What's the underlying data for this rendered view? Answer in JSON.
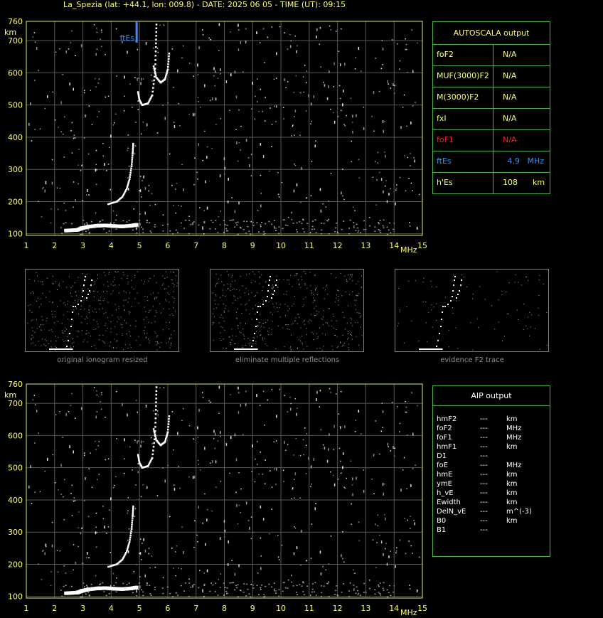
{
  "header": "La_Spezia (lat: +44.1, lon: 009.8) - DATE: 2025 06 05 - TIME (UT): 09:15",
  "colors": {
    "grid": "#5a5a5a",
    "frame": "#e8e870",
    "axis_text": "#ffff66",
    "panel_border": "#4caf50",
    "foF1": "#ff2020",
    "ftEs": "#3a8cff",
    "label_yellow": "#ffff66"
  },
  "chart_data": [
    {
      "type": "scatter",
      "name_id": "main-ionogram",
      "xlabel": "MHz",
      "ylabel": "km",
      "xlim": [
        1,
        15
      ],
      "ylim": [
        95,
        760
      ],
      "xticks": [
        "1",
        "2",
        "3",
        "4",
        "5",
        "6",
        "7",
        "8",
        "9",
        "10",
        "11",
        "12",
        "13",
        "14",
        "15"
      ],
      "yticks": [
        "100",
        "200",
        "300",
        "400",
        "500",
        "600",
        "700",
        "760"
      ],
      "ftEs_marker": {
        "label": "ftEs",
        "x": 4.9
      },
      "traces": [
        {
          "name": "es-layer",
          "points": [
            [
              2.4,
              110
            ],
            [
              2.8,
              112
            ],
            [
              3.0,
              118
            ],
            [
              3.2,
              122
            ],
            [
              3.5,
              125
            ],
            [
              3.8,
              126
            ],
            [
              4.1,
              124
            ],
            [
              4.4,
              123
            ],
            [
              4.7,
              125
            ],
            [
              4.9,
              128
            ]
          ]
        },
        {
          "name": "f1-trace",
          "points": [
            [
              3.9,
              192
            ],
            [
              4.2,
              200
            ],
            [
              4.4,
              215
            ],
            [
              4.55,
              240
            ],
            [
              4.65,
              270
            ],
            [
              4.72,
              310
            ],
            [
              4.76,
              350
            ],
            [
              4.78,
              380
            ]
          ]
        },
        {
          "name": "f2-trace-1",
          "points": [
            [
              4.95,
              540
            ],
            [
              5.0,
              515
            ],
            [
              5.1,
              500
            ],
            [
              5.3,
              505
            ],
            [
              5.45,
              530
            ],
            [
              5.55,
              600
            ],
            [
              5.58,
              680
            ],
            [
              5.6,
              750
            ]
          ]
        },
        {
          "name": "f2-trace-2",
          "points": [
            [
              5.5,
              620
            ],
            [
              5.6,
              585
            ],
            [
              5.75,
              570
            ],
            [
              5.9,
              580
            ],
            [
              6.0,
              610
            ],
            [
              6.05,
              660
            ]
          ]
        }
      ]
    },
    {
      "type": "scatter",
      "name_id": "aip-ionogram",
      "xlabel": "MHz",
      "ylabel": "km",
      "xlim": [
        1,
        15
      ],
      "ylim": [
        95,
        760
      ],
      "xticks": [
        "1",
        "2",
        "3",
        "4",
        "5",
        "6",
        "7",
        "8",
        "9",
        "10",
        "11",
        "12",
        "13",
        "14",
        "15"
      ],
      "yticks": [
        "100",
        "200",
        "300",
        "400",
        "500",
        "600",
        "700",
        "760"
      ]
    }
  ],
  "autoscala": {
    "title": "AUTOSCALA output",
    "rows": [
      {
        "param": "foF2",
        "value": "N/A",
        "unit": ""
      },
      {
        "param": "MUF(3000)F2",
        "value": "N/A",
        "unit": ""
      },
      {
        "param": "M(3000)F2",
        "value": "N/A",
        "unit": ""
      },
      {
        "param": "fxI",
        "value": "N/A",
        "unit": ""
      },
      {
        "param": "foF1",
        "value": "N/A",
        "unit": ""
      },
      {
        "param": "ftEs",
        "value": "4.9",
        "unit": "MHz"
      },
      {
        "param": "h'Es",
        "value": "108",
        "unit": "km"
      }
    ]
  },
  "thumbnails": [
    {
      "caption": "original ionogram resized"
    },
    {
      "caption": "eliminate multiple reflections"
    },
    {
      "caption": "evidence F2 trace"
    }
  ],
  "aip": {
    "title": "AIP output",
    "rows": [
      {
        "param": "hmF2",
        "value": "---",
        "unit": "km"
      },
      {
        "param": "foF2",
        "value": "---",
        "unit": "MHz"
      },
      {
        "param": "foF1",
        "value": "---",
        "unit": "MHz"
      },
      {
        "param": "hmF1",
        "value": "---",
        "unit": "km"
      },
      {
        "param": "D1",
        "value": "---",
        "unit": ""
      },
      {
        "param": "foE",
        "value": "---",
        "unit": "MHz"
      },
      {
        "param": "hmE",
        "value": "---",
        "unit": "km"
      },
      {
        "param": "ymE",
        "value": "---",
        "unit": "km"
      },
      {
        "param": "h_vE",
        "value": "---",
        "unit": "km"
      },
      {
        "param": "Ewidth",
        "value": "---",
        "unit": "km"
      },
      {
        "param": "DelN_vE",
        "value": "---",
        "unit": "m^(-3)"
      },
      {
        "param": "B0",
        "value": "---",
        "unit": "km"
      },
      {
        "param": "B1",
        "value": "---",
        "unit": ""
      }
    ]
  }
}
